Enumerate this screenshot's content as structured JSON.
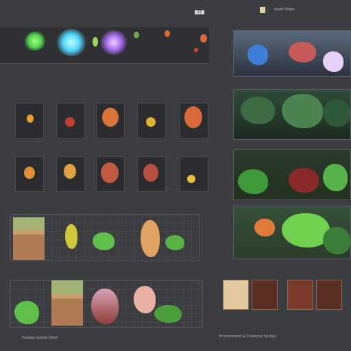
{
  "top_bar": {
    "right_label": "Asset Sheet",
    "badge": "12"
  },
  "sections": {
    "fx_row": [
      "fx-green",
      "fx-cyan",
      "fx-violet"
    ],
    "sprite_rows": 2,
    "tileset_rows": 2
  },
  "environment_panels": [
    "crystal-garden",
    "forest-canopy",
    "red-foliage",
    "swamp-grove"
  ],
  "footer": {
    "left_text": "Fantasy Garden Pack",
    "right_text": "Environment & Character Sprites"
  },
  "thumbs": [
    "item-sheet",
    "character-red",
    "character-pot",
    "character-red-2"
  ],
  "colors": {
    "bg": "#3c3d40",
    "panel": "#333437",
    "accent_green": "#5fbf4a",
    "accent_orange": "#e07a3a"
  }
}
